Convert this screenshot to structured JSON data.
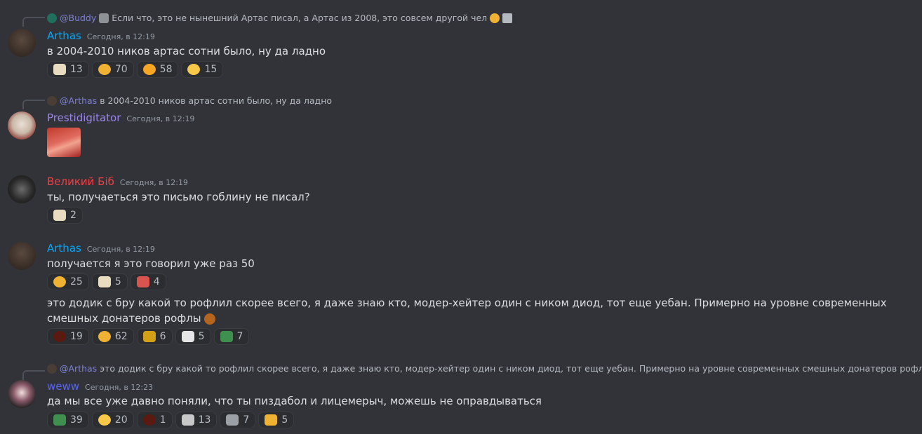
{
  "messages": [
    {
      "reply": {
        "mention": "@Buddy",
        "text": "Если что, это не нынешний Артас писал, а Артас из 2008, это совсем другой чел"
      },
      "author": "Arthas",
      "author_color": "#00a8fc",
      "timestamp": "Сегодня, в 12:19",
      "text": "в 2004-2010 ников артас сотни было, ну да ладно",
      "reactions": [
        {
          "emoji": "paper-emoji",
          "count": "13"
        },
        {
          "emoji": "thinking-emoji",
          "count": "70"
        },
        {
          "emoji": "hand-face-emoji",
          "count": "58"
        },
        {
          "emoji": "face-emoji",
          "count": "15"
        }
      ]
    },
    {
      "reply": {
        "mention": "@Arthas",
        "text": "в 2004-2010 ников артас сотни было, ну да ладно"
      },
      "author": "Prestidigitator",
      "author_color": "#9b84ec",
      "timestamp": "Сегодня, в 12:19",
      "attachment": "anime-image"
    },
    {
      "author": "Великий Біб",
      "author_color": "#f23f43",
      "timestamp": "Сегодня, в 12:19",
      "text": "ты, получаеться это письмо гоблину не писал?",
      "reactions": [
        {
          "emoji": "paper-emoji",
          "count": "2"
        }
      ]
    },
    {
      "author": "Arthas",
      "author_color": "#00a8fc",
      "timestamp": "Сегодня, в 12:19",
      "text": "получается я это говорил уже раз 50",
      "reactions": [
        {
          "emoji": "thinking-emoji",
          "count": "25"
        },
        {
          "emoji": "paper-emoji",
          "count": "5"
        },
        {
          "emoji": "red-face-emoji",
          "count": "4"
        }
      ],
      "text2": "это додик с бру какой то рофлил скорее всего, я даже знаю кто, модер-хейтер один с ником диод, тот еще уебан. Примерно на уровне современных смешных донатеров рофлы",
      "reactions2": [
        {
          "emoji": "eye-emoji",
          "count": "19"
        },
        {
          "emoji": "thinking-emoji",
          "count": "62"
        },
        {
          "emoji": "gold-emoji",
          "count": "6"
        },
        {
          "emoji": "ambulance-emoji",
          "count": "5"
        },
        {
          "emoji": "green-emoji",
          "count": "7"
        }
      ]
    },
    {
      "reply": {
        "mention": "@Arthas",
        "text": "это додик с бру какой то рофлил скорее всего, я даже знаю кто, модер-хейтер один с ником диод, тот еще уебан. Примерно на уровне современных смешных донатеров рофлы"
      },
      "author": "weww",
      "author_color": "#5865f2",
      "timestamp": "Сегодня, в 12:23",
      "text": "да мы все уже давно поняли, что ты пиздабол и лицемерыч, можешь не оправдываться",
      "reactions": [
        {
          "emoji": "green-emoji",
          "count": "39"
        },
        {
          "emoji": "face-emoji",
          "count": "20"
        },
        {
          "emoji": "eye-emoji",
          "count": "1"
        },
        {
          "emoji": "skull-emoji",
          "count": "13"
        },
        {
          "emoji": "glasses-emoji",
          "count": "7"
        },
        {
          "emoji": "thumb-emoji",
          "count": "5"
        }
      ]
    }
  ]
}
